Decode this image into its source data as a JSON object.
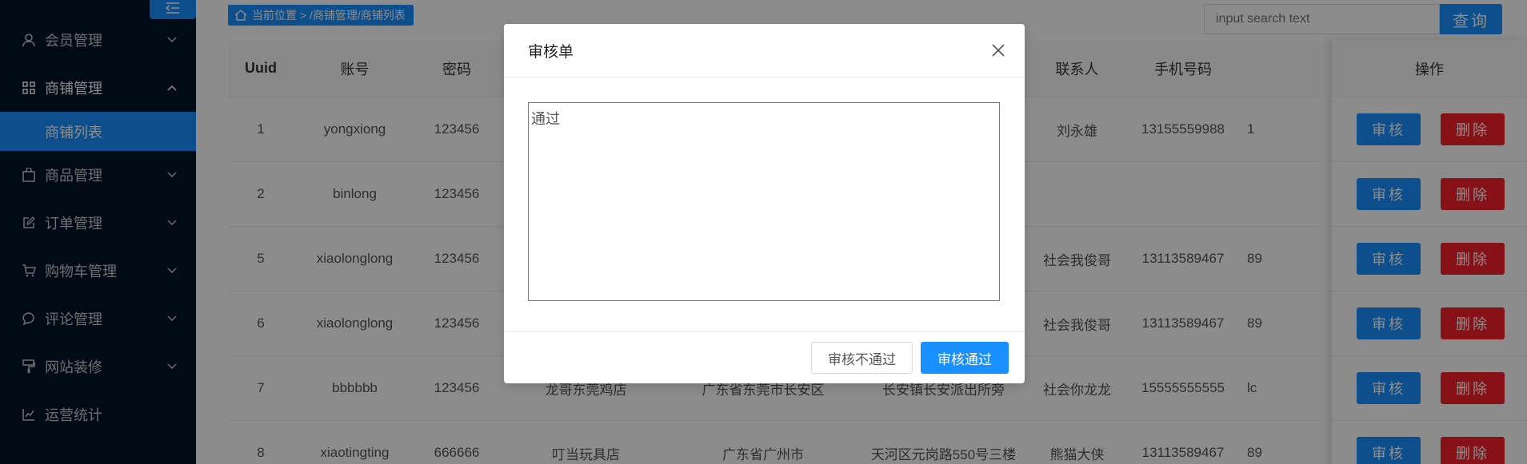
{
  "sidebar": {
    "items": [
      {
        "label": "会员管理",
        "icon": "user-icon",
        "open": false
      },
      {
        "label": "商铺管理",
        "icon": "grid-icon",
        "open": true,
        "children": [
          {
            "label": "商铺列表"
          }
        ]
      },
      {
        "label": "商品管理",
        "icon": "bag-icon",
        "open": false
      },
      {
        "label": "订单管理",
        "icon": "edit-icon",
        "open": false
      },
      {
        "label": "购物车管理",
        "icon": "cart-icon",
        "open": false
      },
      {
        "label": "评论管理",
        "icon": "comment-icon",
        "open": false
      },
      {
        "label": "网站装修",
        "icon": "brush-icon",
        "open": false
      },
      {
        "label": "运营统计",
        "icon": "chart-icon",
        "open": false
      }
    ]
  },
  "breadcrumb": {
    "text": "当前位置 > /商铺管理/商铺列表"
  },
  "search": {
    "placeholder": "input search text",
    "button_label": "查询"
  },
  "table": {
    "headers": {
      "uuid": "Uuid",
      "account": "账号",
      "password": "密码",
      "contact": "联系人",
      "phone": "手机号码",
      "actions": "操作"
    },
    "rows": [
      {
        "uuid": "1",
        "account": "yongxiong",
        "password": "123456",
        "shop": "",
        "area": "",
        "address": "",
        "contact": "刘永雄",
        "phone": "13155559988",
        "extra": "1"
      },
      {
        "uuid": "2",
        "account": "binlong",
        "password": "123456",
        "shop": "",
        "area": "",
        "address": "",
        "contact": "",
        "phone": "",
        "extra": ""
      },
      {
        "uuid": "5",
        "account": "xiaolonglong",
        "password": "123456",
        "shop": "",
        "area": "",
        "address": "",
        "contact": "社会我俊哥",
        "phone": "13113589467",
        "extra": "89"
      },
      {
        "uuid": "6",
        "account": "xiaolonglong",
        "password": "123456",
        "shop": "",
        "area": "",
        "address": "",
        "contact": "社会我俊哥",
        "phone": "13113589467",
        "extra": "89"
      },
      {
        "uuid": "7",
        "account": "bbbbbb",
        "password": "123456",
        "shop": "龙哥东莞鸡店",
        "area": "广东省东莞市长安区",
        "address": "长安镇长安派出所旁",
        "contact": "社会你龙龙",
        "phone": "15555555555",
        "extra": "lc"
      },
      {
        "uuid": "8",
        "account": "xiaotingting",
        "password": "666666",
        "shop": "叮当玩具店",
        "area": "广东省广州市",
        "address": "天河区元岗路550号三楼",
        "contact": "熊猫大侠",
        "phone": "13113589467",
        "extra": "89"
      }
    ],
    "audit_label": "审核",
    "delete_label": "删除"
  },
  "modal": {
    "title": "审核单",
    "textarea_value": "通过",
    "reject_label": "审核不通过",
    "pass_label": "审核通过"
  },
  "colors": {
    "primary": "#1890ff",
    "danger": "#f5222d",
    "sidebar": "#001529"
  }
}
